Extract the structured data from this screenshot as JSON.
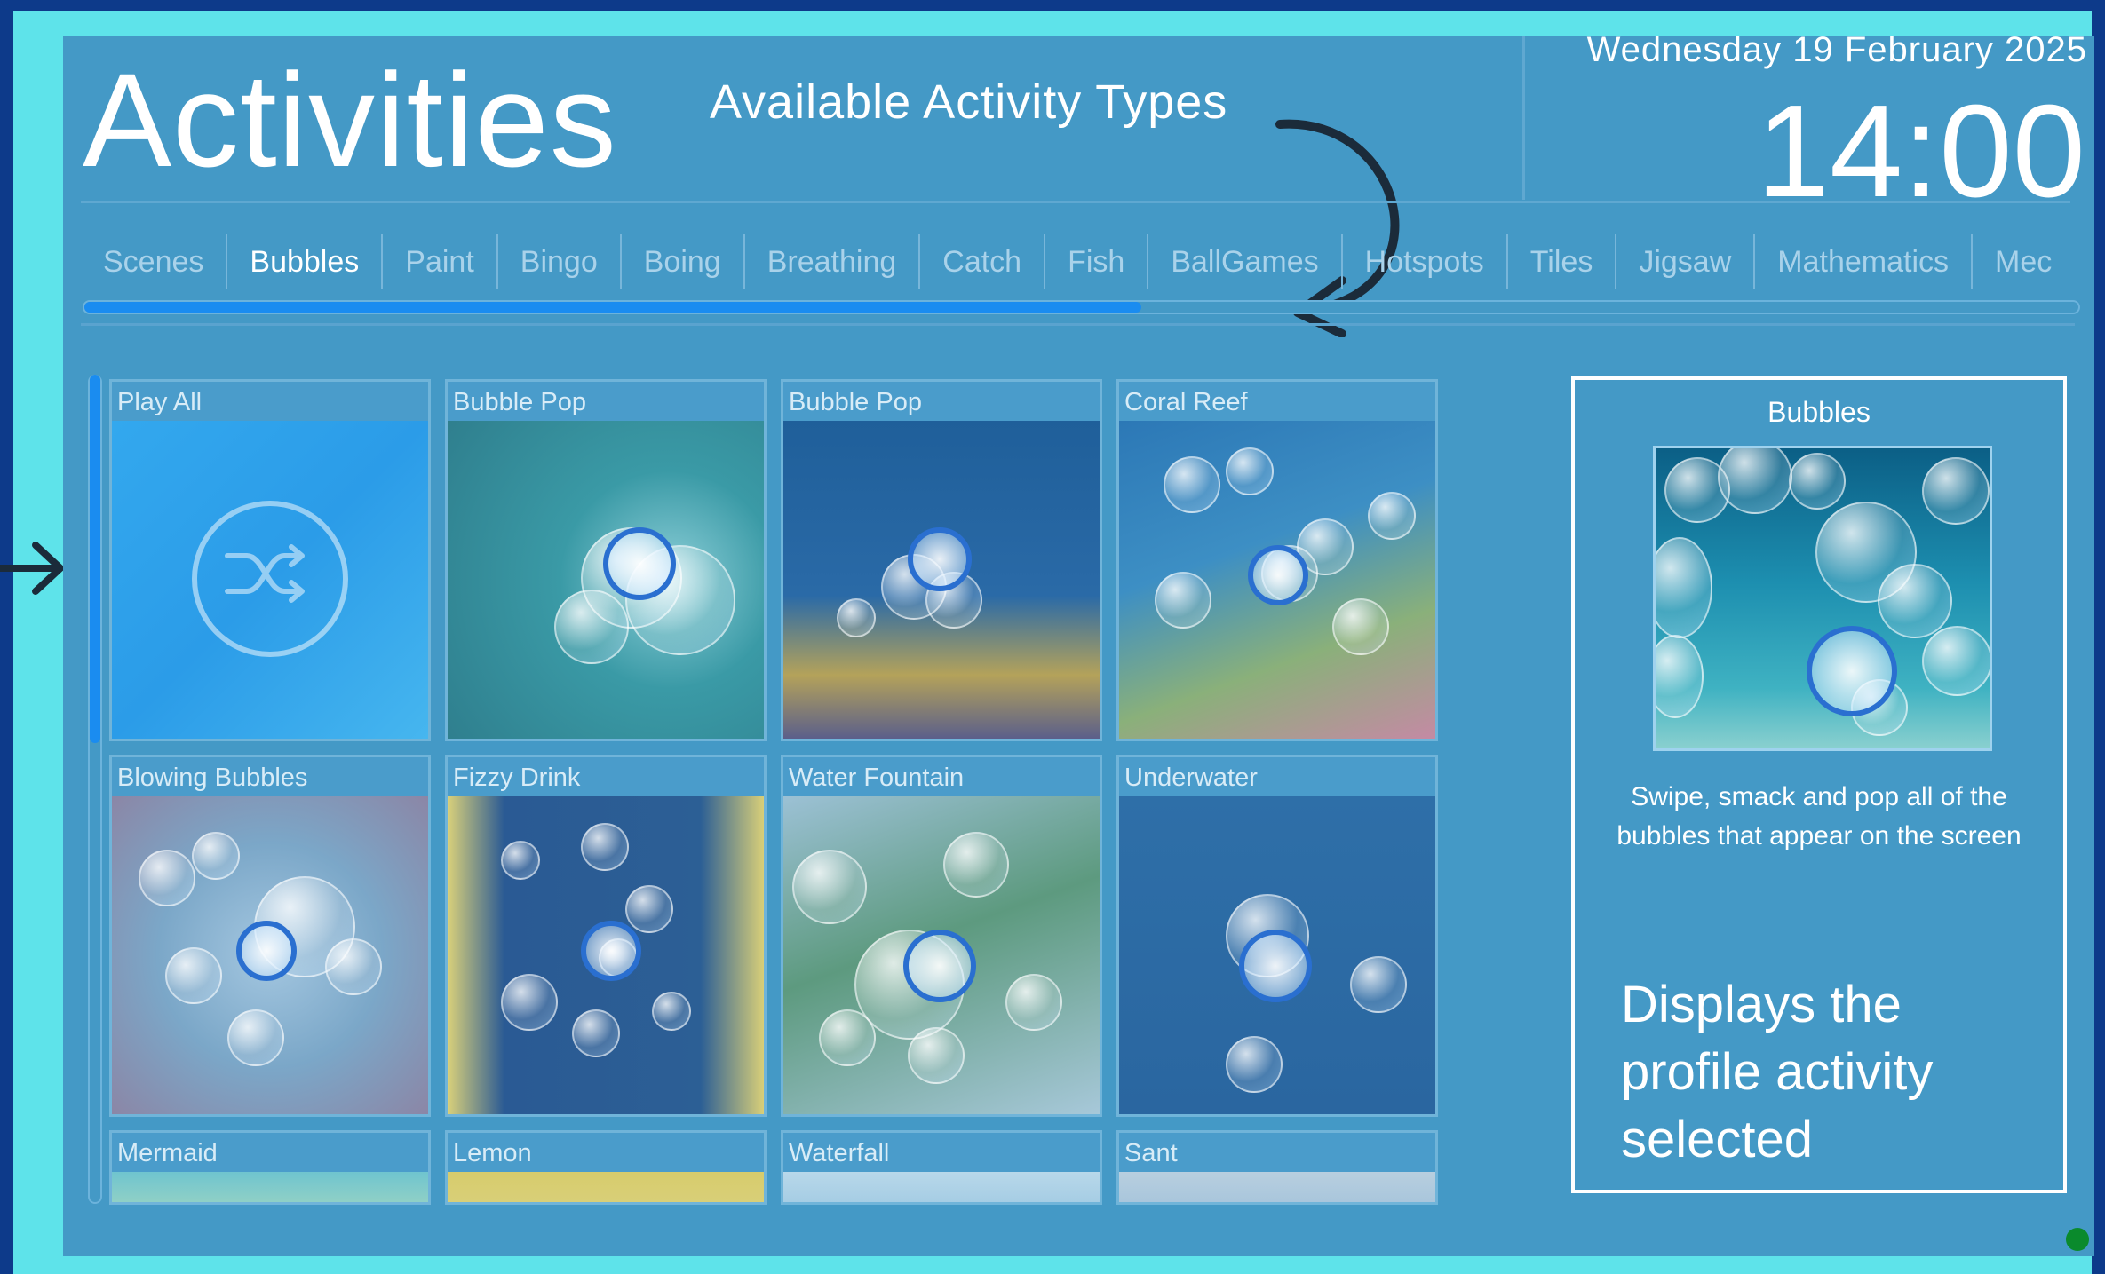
{
  "header": {
    "title": "Activities",
    "annotation_types": "Available Activity Types",
    "date": "Wednesday 19 February 2025",
    "time": "14:00"
  },
  "tabs": [
    {
      "label": "Scenes",
      "active": false
    },
    {
      "label": "Bubbles",
      "active": true
    },
    {
      "label": "Paint",
      "active": false
    },
    {
      "label": "Bingo",
      "active": false
    },
    {
      "label": "Boing",
      "active": false
    },
    {
      "label": "Breathing",
      "active": false
    },
    {
      "label": "Catch",
      "active": false
    },
    {
      "label": "Fish",
      "active": false
    },
    {
      "label": "BallGames",
      "active": false
    },
    {
      "label": "Hotspots",
      "active": false
    },
    {
      "label": "Tiles",
      "active": false
    },
    {
      "label": "Jigsaw",
      "active": false
    },
    {
      "label": "Mathematics",
      "active": false
    },
    {
      "label": "Mec",
      "active": false
    }
  ],
  "tab_scroll": {
    "progress": 0.53
  },
  "grid_scroll": {
    "progress": 0.45
  },
  "activities": [
    {
      "title": "Play All",
      "icon": "shuffle-icon"
    },
    {
      "title": "Bubble Pop"
    },
    {
      "title": "Bubble Pop"
    },
    {
      "title": "Coral Reef"
    },
    {
      "title": "Blowing Bubbles"
    },
    {
      "title": "Fizzy Drink"
    },
    {
      "title": "Water Fountain"
    },
    {
      "title": "Underwater"
    },
    {
      "title": "Mermaid"
    },
    {
      "title": "Lemon"
    },
    {
      "title": "Waterfall"
    },
    {
      "title": "Sant"
    }
  ],
  "panel": {
    "title": "Bubbles",
    "description": "Swipe, smack and pop all of the bubbles that appear on the screen",
    "annotation": "Displays the profile activity selected"
  },
  "colors": {
    "background": "#0d3a8a",
    "frame": "#5ee3ea",
    "screen": "#4499c6",
    "accent": "#1a8cf0",
    "status": "#0a8a2c"
  }
}
